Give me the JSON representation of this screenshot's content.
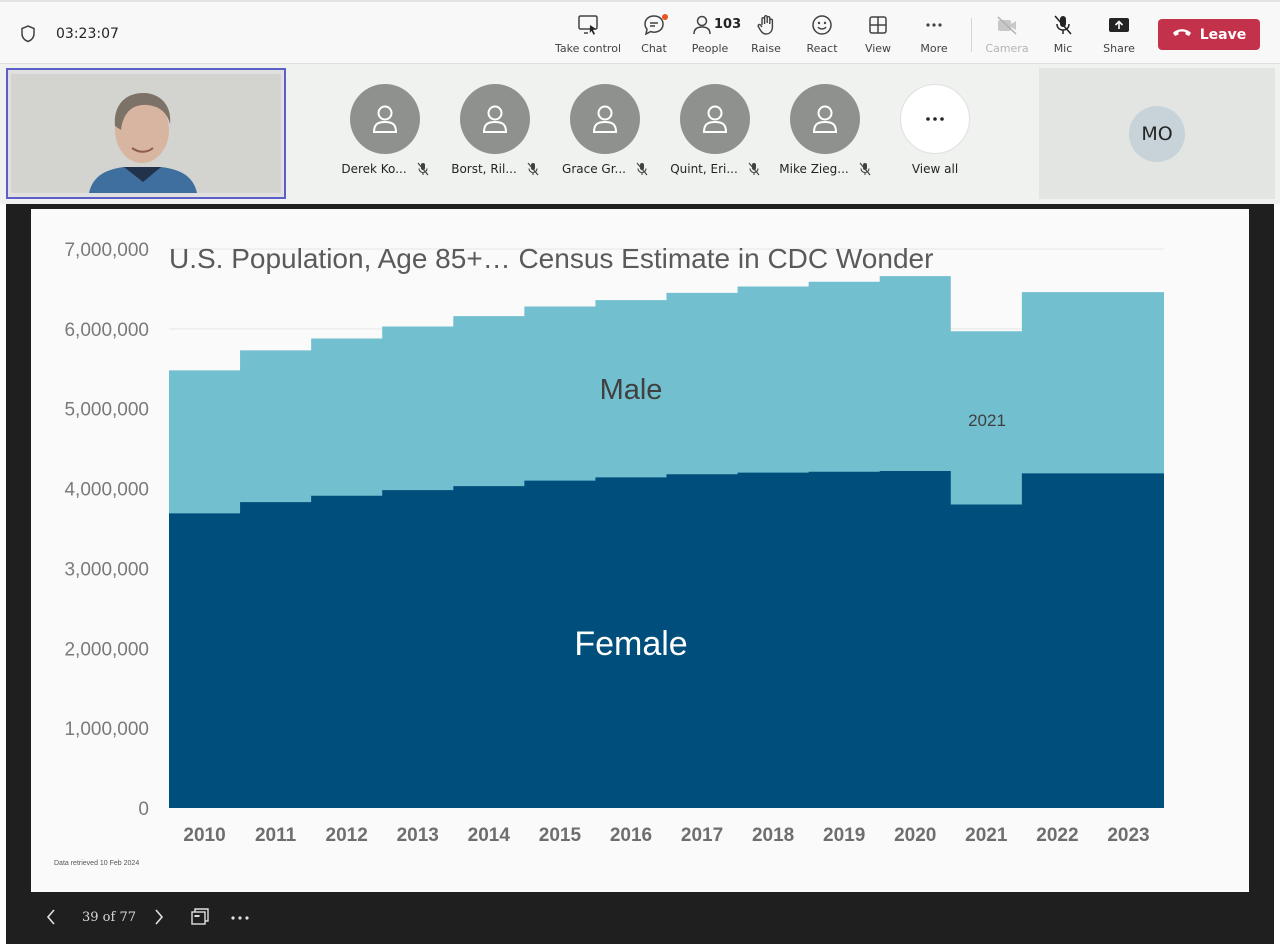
{
  "meeting": {
    "timer": "03:23:07",
    "buttons": [
      {
        "label": "Take control",
        "icon": "take-control-icon"
      },
      {
        "label": "Chat",
        "icon": "chat-icon"
      },
      {
        "label": "People",
        "icon": "people-icon",
        "count": "103"
      },
      {
        "label": "Raise",
        "icon": "raise-hand-icon"
      },
      {
        "label": "React",
        "icon": "react-icon"
      },
      {
        "label": "View",
        "icon": "view-icon"
      },
      {
        "label": "More",
        "icon": "more-icon"
      },
      {
        "label": "Camera",
        "icon": "camera-off-icon",
        "disabled": true
      },
      {
        "label": "Mic",
        "icon": "mic-off-icon"
      },
      {
        "label": "Share",
        "icon": "share-icon"
      }
    ],
    "leave_label": "Leave",
    "colors": {
      "leave": "#c4314b",
      "accent": "#5b5fc7"
    }
  },
  "participants": [
    {
      "name": "Derek Ko...",
      "muted": true
    },
    {
      "name": "Borst, Ril...",
      "muted": true
    },
    {
      "name": "Grace Gr...",
      "muted": true
    },
    {
      "name": "Quint, Eri...",
      "muted": true
    },
    {
      "name": "Mike Zieg...",
      "muted": true
    }
  ],
  "view_all_label": "View all",
  "spotlight_initials": "MO",
  "slide": {
    "footnote": "Data retrieved 10 Feb 2024",
    "page_indicator": "39 of 77"
  },
  "chart_data": {
    "type": "area",
    "title": "U.S. Population, Age 85+… Census Estimate in CDC Wonder",
    "categories": [
      "2010",
      "2011",
      "2012",
      "2013",
      "2014",
      "2015",
      "2016",
      "2017",
      "2018",
      "2019",
      "2020",
      "2021",
      "2022",
      "2023"
    ],
    "series": [
      {
        "name": "Female",
        "color": "#004e7c",
        "values": [
          3690000,
          3830000,
          3910000,
          3980000,
          4030000,
          4100000,
          4140000,
          4180000,
          4200000,
          4210000,
          4220000,
          3800000,
          4190000,
          4190000
        ]
      },
      {
        "name": "Male",
        "color": "#72bfcf",
        "values": [
          1790000,
          1900000,
          1970000,
          2050000,
          2130000,
          2180000,
          2220000,
          2270000,
          2330000,
          2380000,
          2440000,
          2170000,
          2270000,
          2270000
        ]
      }
    ],
    "totals": [
      5480000,
      5730000,
      5880000,
      6030000,
      6160000,
      6280000,
      6360000,
      6450000,
      6530000,
      6590000,
      6660000,
      5970000,
      6460000,
      6460000
    ],
    "ylim": [
      0,
      7000000
    ],
    "yticks": [
      "0",
      "1,000,000",
      "2,000,000",
      "3,000,000",
      "4,000,000",
      "5,000,000",
      "6,000,000",
      "7,000,000"
    ],
    "annotations": {
      "male_label": "Male",
      "female_label": "Female",
      "year_note": "2021"
    },
    "grid": true
  }
}
